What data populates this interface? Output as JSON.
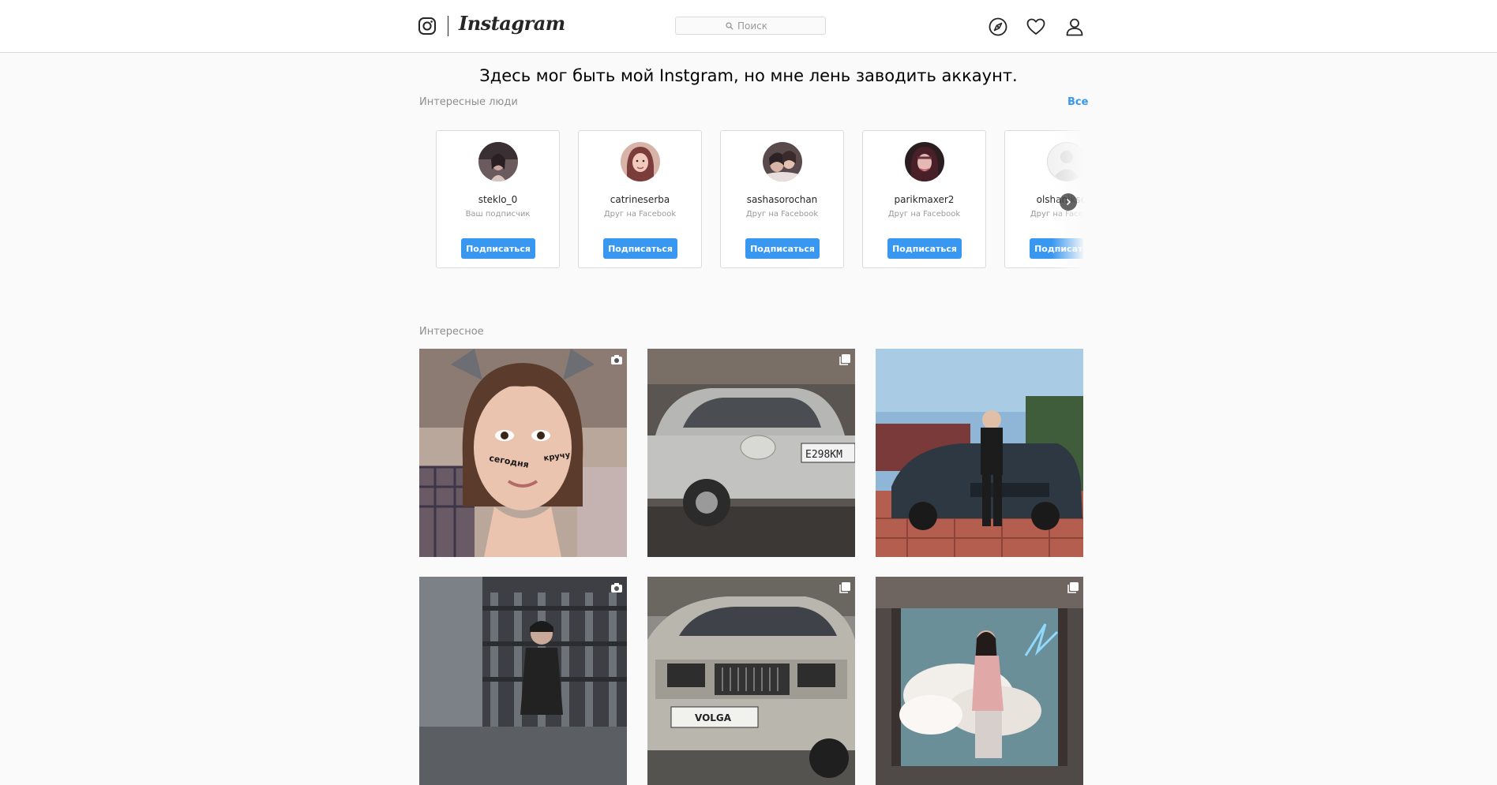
{
  "header": {
    "brand": "Instagram",
    "search_placeholder": "Поиск",
    "icons": [
      "instagram-glyph-icon",
      "explore-compass-icon",
      "activity-heart-icon",
      "profile-person-icon"
    ]
  },
  "banner_text": "Здесь мог быть мой Instgram, но мне лень заводить аккаунт.",
  "suggestions": {
    "title": "Интересные люди",
    "see_all": "Все",
    "follow_label": "Подписаться",
    "cards": [
      {
        "username": "steklo_0",
        "subtitle": "Ваш подписчик"
      },
      {
        "username": "catrineserba",
        "subtitle": "Друг на Facebook"
      },
      {
        "username": "sashasorochan",
        "subtitle": "Друг на Facebook"
      },
      {
        "username": "parikmaxer2",
        "subtitle": "Друг на Facebook"
      },
      {
        "username": "olshanikserg",
        "subtitle": "Друг на Facebook"
      }
    ]
  },
  "explore": {
    "title": "Интересное",
    "tiles": [
      {
        "subject": "woman with stickers on cheeks",
        "badge": "video-icon",
        "caption_text": [
          "сегодня",
          "кручу"
        ]
      },
      {
        "subject": "silver Volga sedan",
        "badge": "multiple-photos-icon",
        "plate": "Е298КМ"
      },
      {
        "subject": "man standing next to black car",
        "badge": "none"
      },
      {
        "subject": "woman on city street",
        "badge": "video-icon"
      },
      {
        "subject": "silver Volga front view",
        "badge": "multiple-photos-icon",
        "plate": "VOLGA"
      },
      {
        "subject": "woman in smoke room",
        "badge": "multiple-photos-icon"
      }
    ]
  },
  "colors": {
    "accent": "#3897f0",
    "background": "#fafafa",
    "border": "#dbdbdb"
  }
}
